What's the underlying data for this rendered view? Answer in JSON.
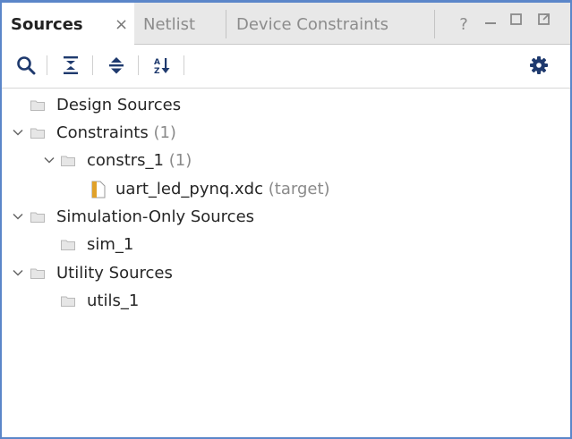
{
  "tabs": [
    {
      "label": "Sources",
      "active": true
    },
    {
      "label": "Netlist",
      "active": false
    },
    {
      "label": "Device Constraints",
      "active": false
    }
  ],
  "tab_close_glyph": "×",
  "window_buttons": {
    "help": "?",
    "minimize": "_",
    "maximize": "□",
    "float": "⧉"
  },
  "toolbar": {
    "icons": [
      "search-icon",
      "collapse-all-icon",
      "expand-all-icon",
      "sort-icon"
    ],
    "settings_icon": "gear-icon"
  },
  "tree": [
    {
      "label": "Design Sources",
      "count": "",
      "expanded": null
    },
    {
      "label": "Constraints",
      "count": "(1)",
      "expanded": true
    },
    {
      "label": "constrs_1",
      "count": "(1)",
      "expanded": true
    },
    {
      "label": "uart_led_pynq.xdc",
      "count": "(target)",
      "expanded": null
    },
    {
      "label": "Simulation-Only Sources",
      "count": "",
      "expanded": true
    },
    {
      "label": "sim_1",
      "count": "",
      "expanded": null
    },
    {
      "label": "Utility Sources",
      "count": "",
      "expanded": true
    },
    {
      "label": "utils_1",
      "count": "",
      "expanded": null
    }
  ],
  "colors": {
    "accent_border": "#5b86c9",
    "gear": "#1f3a6e",
    "file_icon": "#e0a12a"
  }
}
